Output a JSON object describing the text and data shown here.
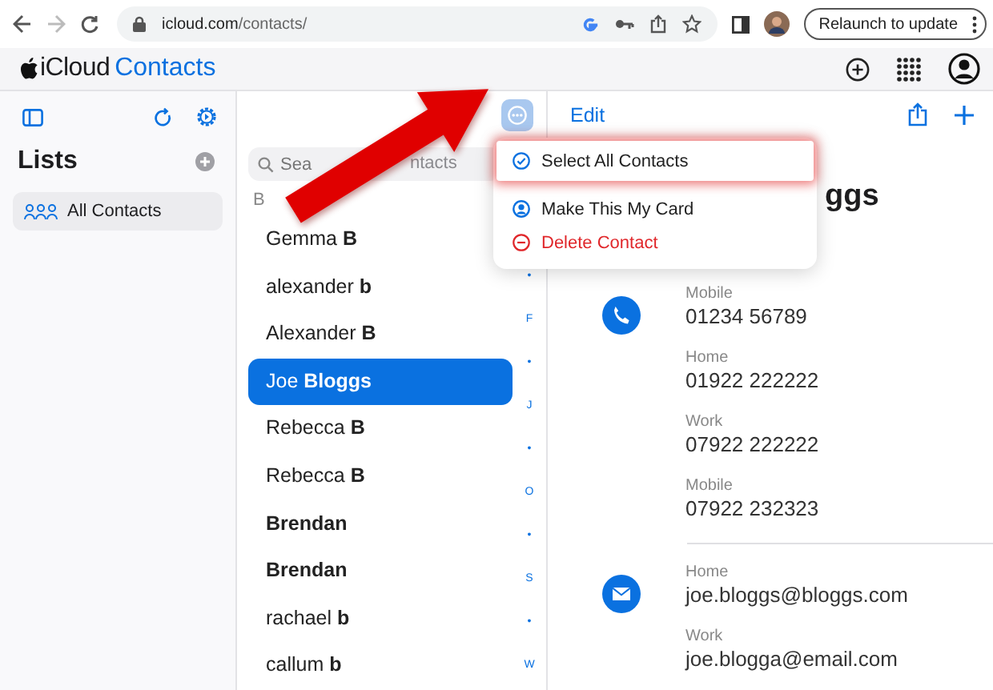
{
  "browser": {
    "url_host": "icloud.com",
    "url_path": "/contacts/",
    "update_button": "Relaunch to update"
  },
  "app": {
    "brand": "iCloud",
    "title": "Contacts"
  },
  "sidebar": {
    "heading": "Lists",
    "items": [
      {
        "label": "All Contacts",
        "selected": true
      }
    ]
  },
  "contact_list": {
    "search": {
      "placeholder": "Sea",
      "placeholder_tail": "ntacts"
    },
    "section": "B",
    "contacts": [
      {
        "first": "Gemma",
        "last": "B",
        "selected": false
      },
      {
        "first": "alexander",
        "last": "b",
        "selected": false
      },
      {
        "first": "Alexander",
        "last": "B",
        "selected": false
      },
      {
        "first": "Joe",
        "last": "Bloggs",
        "selected": true
      },
      {
        "first": "Rebecca",
        "last": "B",
        "selected": false
      },
      {
        "first": "Rebecca",
        "last": "B",
        "selected": false
      },
      {
        "last": "Brendan",
        "selected": false
      },
      {
        "last": "Brendan",
        "selected": false
      },
      {
        "first": "rachael",
        "last": "b",
        "selected": false
      },
      {
        "first": "callum",
        "last": "b",
        "selected": false
      }
    ],
    "index": [
      "•",
      "F",
      "•",
      "J",
      "•",
      "O",
      "•",
      "S",
      "•",
      "W"
    ]
  },
  "menu": {
    "items": [
      {
        "kind": "select",
        "label": "Select All Contacts",
        "highlighted": true
      },
      {
        "kind": "card",
        "label": "Make This My Card",
        "highlighted": false
      },
      {
        "kind": "delete",
        "label": "Delete Contact",
        "highlighted": false
      }
    ]
  },
  "detail": {
    "edit": "Edit",
    "name_visible": "ggs",
    "groups": [
      {
        "kind": "phone",
        "entries": [
          {
            "label": "Mobile",
            "value": "01234 56789"
          },
          {
            "label": "Home",
            "value": "01922 222222"
          },
          {
            "label": "Work",
            "value": "07922 222222"
          },
          {
            "label": "Mobile",
            "value": "07922 232323"
          }
        ]
      },
      {
        "kind": "email",
        "entries": [
          {
            "label": "Home",
            "value": "joe.bloggs@bloggs.com"
          },
          {
            "label": "Work",
            "value": "joe.blogga@email.com"
          }
        ]
      }
    ]
  },
  "annotation": {
    "arrow": true
  }
}
